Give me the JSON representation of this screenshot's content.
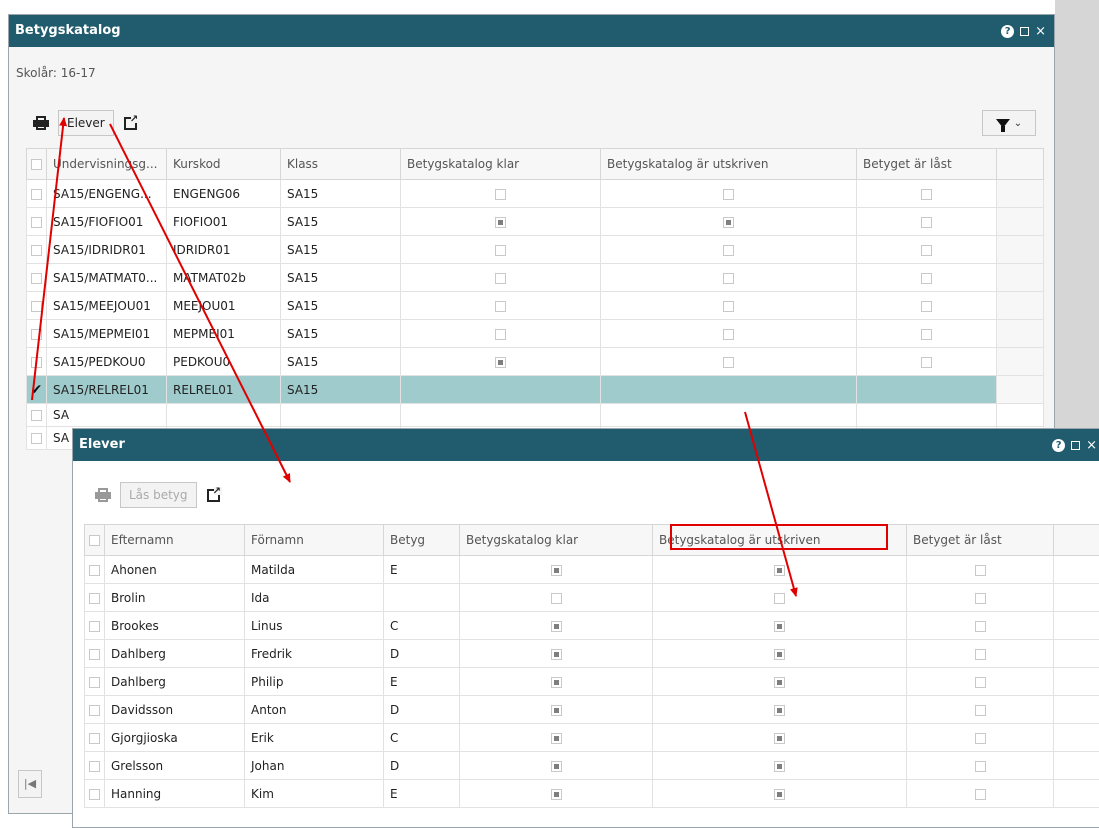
{
  "outer": {
    "title": "Betygskatalog",
    "school_year": "Skolår: 16-17",
    "toolbar": {
      "students_label": "Elever"
    },
    "columns": [
      "Undervisningsg...",
      "Kurskod",
      "Klass",
      "Betygskatalog klar",
      "Betygskatalog är utskriven",
      "Betyget är låst"
    ],
    "rows": [
      {
        "group": "SA15/ENGENG...",
        "code": "ENGENG06",
        "class": "SA15",
        "klar": false,
        "utskriven": false,
        "last": false
      },
      {
        "group": "SA15/FIOFIO01",
        "code": "FIOFIO01",
        "class": "SA15",
        "klar": true,
        "utskriven": true,
        "last": false
      },
      {
        "group": "SA15/IDRIDR01",
        "code": "IDRIDR01",
        "class": "SA15",
        "klar": false,
        "utskriven": false,
        "last": false
      },
      {
        "group": "SA15/MATMAT0...",
        "code": "MATMAT02b",
        "class": "SA15",
        "klar": false,
        "utskriven": false,
        "last": false
      },
      {
        "group": "SA15/MEEJOU01",
        "code": "MEEJOU01",
        "class": "SA15",
        "klar": false,
        "utskriven": false,
        "last": false
      },
      {
        "group": "SA15/MEPMEI01",
        "code": "MEPMEI01",
        "class": "SA15",
        "klar": false,
        "utskriven": false,
        "last": false
      },
      {
        "group": "SA15/PEDKOU0",
        "code": "PEDKOU0",
        "class": "SA15",
        "klar": true,
        "utskriven": false,
        "last": false
      },
      {
        "group": "SA15/RELREL01",
        "code": "RELREL01",
        "class": "SA15",
        "selected": true
      }
    ],
    "partial_rows": [
      "SA",
      "SA"
    ],
    "pager_first": "|◀"
  },
  "inner": {
    "title": "Elever",
    "toolbar": {
      "lock_label": "Lås betyg"
    },
    "columns": [
      "Efternamn",
      "Förnamn",
      "Betyg",
      "Betygskatalog klar",
      "Betygskatalog är utskriven",
      "Betyget är låst"
    ],
    "rows": [
      {
        "last_name": "Ahonen",
        "first_name": "Matilda",
        "grade": "E",
        "klar": true,
        "utskriven": true,
        "last": false
      },
      {
        "last_name": "Brolin",
        "first_name": "Ida",
        "grade": "",
        "klar": false,
        "utskriven": false,
        "last": false
      },
      {
        "last_name": "Brookes",
        "first_name": "Linus",
        "grade": "C",
        "klar": true,
        "utskriven": true,
        "last": false
      },
      {
        "last_name": "Dahlberg",
        "first_name": "Fredrik",
        "grade": "D",
        "klar": true,
        "utskriven": true,
        "last": false
      },
      {
        "last_name": "Dahlberg",
        "first_name": "Philip",
        "grade": "E",
        "klar": true,
        "utskriven": true,
        "last": false
      },
      {
        "last_name": "Davidsson",
        "first_name": "Anton",
        "grade": "D",
        "klar": true,
        "utskriven": true,
        "last": false
      },
      {
        "last_name": "Gjorgjioska",
        "first_name": "Erik",
        "grade": "C",
        "klar": true,
        "utskriven": true,
        "last": false
      },
      {
        "last_name": "Grelsson",
        "first_name": "Johan",
        "grade": "D",
        "klar": true,
        "utskriven": true,
        "last": false
      },
      {
        "last_name": "Hanning",
        "first_name": "Kim",
        "grade": "E",
        "klar": true,
        "utskriven": true,
        "last": false
      }
    ]
  },
  "colors": {
    "title_bar": "#215c6e",
    "selected_row": "#9fcbcc",
    "annotation": "#e00000"
  }
}
